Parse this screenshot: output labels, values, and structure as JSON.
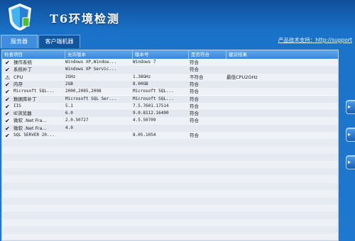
{
  "app": {
    "title": "T6环境检测",
    "support_link": "产品技术支持：http://support"
  },
  "tabs": [
    {
      "label": "服务器",
      "active": true
    },
    {
      "label": "客户端机器",
      "active": false
    }
  ],
  "table": {
    "columns": [
      "检查项目",
      "允许版本",
      "版本号",
      "是否符合",
      "建议结果"
    ],
    "rows": [
      {
        "icon": "check-icon",
        "name": "操作系统",
        "allowed": "Windows XP,Window...",
        "version": "Windows 7",
        "status": "符合",
        "advice": ""
      },
      {
        "icon": "check-icon",
        "name": "系统补丁",
        "allowed": "Windows XP Servic...",
        "version": "",
        "status": "符合",
        "advice": ""
      },
      {
        "icon": "warning-icon",
        "name": "CPU",
        "allowed": "2GHz",
        "version": "1.38GHz",
        "status": "不符合",
        "advice": "最低CPU2GHz"
      },
      {
        "icon": "check-icon",
        "name": "内存",
        "allowed": "2GB",
        "version": "8.00GB",
        "status": "符合",
        "advice": ""
      },
      {
        "icon": "check-icon",
        "name": "Microsoft SQL...",
        "allowed": "2000,2005,2008",
        "version": "Microsoft SQL...",
        "status": "符合",
        "advice": ""
      },
      {
        "icon": "check-icon",
        "name": "数据库补丁",
        "allowed": "Microsoft SQL Ser...",
        "version": "Microsoft SQL...",
        "status": "符合",
        "advice": ""
      },
      {
        "icon": "check-icon",
        "name": "IIS",
        "allowed": "5.1",
        "version": "7.5.7601.17514",
        "status": "符合",
        "advice": ""
      },
      {
        "icon": "check-icon",
        "name": "IE浏览器",
        "allowed": "6.0",
        "version": "9.0.8112.16490",
        "status": "符合",
        "advice": ""
      },
      {
        "icon": "check-icon",
        "name": "微软 .Net Fra...",
        "allowed": "2.0.50727",
        "version": "4.5.50709",
        "status": "符合",
        "advice": ""
      },
      {
        "icon": "check-icon",
        "name": "微软 .Net Fra...",
        "allowed": "4.0",
        "version": "",
        "status": "",
        "advice": ""
      },
      {
        "icon": "check-icon",
        "name": "SQL SERVER 20...",
        "allowed": "",
        "version": "8.05.1054",
        "status": "符合",
        "advice": ""
      }
    ]
  }
}
